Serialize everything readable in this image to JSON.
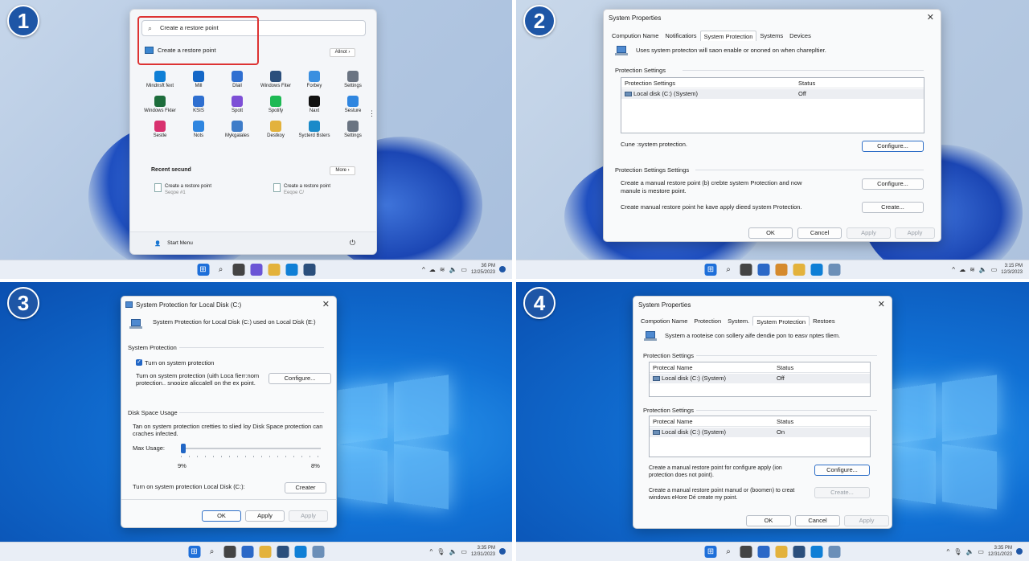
{
  "steps": [
    "1",
    "2",
    "3",
    "4"
  ],
  "q1": {
    "search_value": "Create a restore point",
    "result_label": "Create a restore point",
    "all_label": "Allnot",
    "apps": [
      {
        "label": "Mindnsft fext",
        "icon": "edge-icon",
        "color": "#0f7fd6"
      },
      {
        "label": "Mill",
        "icon": "mail-icon",
        "color": "#1467c7"
      },
      {
        "label": "Dlail",
        "icon": "calendar-icon",
        "color": "#2f6fd1"
      },
      {
        "label": "Windows Fiter",
        "icon": "store-icon",
        "color": "#2b4f7c"
      },
      {
        "label": "Forbey",
        "icon": "photos-icon",
        "color": "#3a8fe0"
      },
      {
        "label": "Settings",
        "icon": "gear-icon",
        "color": "#6a7482"
      },
      {
        "label": "Windows Fkter",
        "icon": "office-icon",
        "color": "#1d6d3c"
      },
      {
        "label": "KSIS",
        "icon": "xbox-icon",
        "color": "#2e6fd0"
      },
      {
        "label": "Spott",
        "icon": "visual-studio-icon",
        "color": "#7d4fd6"
      },
      {
        "label": "Spotify",
        "icon": "spotify-icon",
        "color": "#1db954"
      },
      {
        "label": "Naxt",
        "icon": "netflix-icon",
        "color": "#111111"
      },
      {
        "label": "Sesture",
        "icon": "todo-icon",
        "color": "#2f86e0"
      },
      {
        "label": "Sestle",
        "icon": "instagram-icon",
        "color": "#d8316f"
      },
      {
        "label": "Nots",
        "icon": "check-icon",
        "color": "#2f86e0"
      },
      {
        "label": "Mykgalales",
        "icon": "gallery-icon",
        "color": "#3d7cc9"
      },
      {
        "label": "Destkoy",
        "icon": "folder-icon",
        "color": "#e3b23c"
      },
      {
        "label": "Sycterd Bsters",
        "icon": "snipping-icon",
        "color": "#1a8ac9"
      },
      {
        "label": "Settings",
        "icon": "gear-icon",
        "color": "#6a7482"
      }
    ],
    "recent_heading": "Recent secund",
    "more_label": "More",
    "recent": [
      {
        "title": "Create a restore point",
        "sub": "Seqoe #1"
      },
      {
        "title": "Create a restore point",
        "sub": "Eeqoe C/"
      }
    ],
    "user_label": "Start Menu",
    "clock_time": "3б PM",
    "clock_date": "12/25/2023"
  },
  "q2": {
    "title": "System Properties",
    "tabs": [
      "Compution Name",
      "Notificatiors",
      "System Protection",
      "Systems",
      "Devices"
    ],
    "intro": "Uses system protecton will saon enable or ononed on when charepltier.",
    "section1": "Protection Settings",
    "col1": "Protection Settings",
    "col2": "Status",
    "row_drive": "Local disk (C:) (System)",
    "row_status": "Off",
    "cune_label": "Cune :system protection.",
    "configure": "Configure...",
    "section2": "Protection Settings Settings",
    "desc1": "Create a manual restore point (b) crebte system Protection and now manule is mestore point.",
    "configure2": "Configure...",
    "desc2": "Create manual restore point he kave apply dieed system Protection.",
    "create": "Create...",
    "ok": "OK",
    "cancel": "Cancel",
    "apply1": "Apply",
    "apply2": "Apply",
    "clock_time": "3:15 PM",
    "clock_date": "12/3/2023"
  },
  "q3": {
    "title": "System Protection for Local Disk (C:)",
    "intro": "System Protection for Local Disk (C:) used on Local Disk (E:)",
    "section1": "System Protection",
    "checkbox_label": "Turn on system protection",
    "desc1": "Turn on system protection (uith Loca fierr:nom protection.. snooize aliccalell on the ex point.",
    "configure": "Configure...",
    "section2": "Disk Space Usage",
    "desc2": "Tan on system protection cretties to slied loy Disk Space protection can craches infected.",
    "max_usage_label": "Max Usage:",
    "slider_value": 0.0,
    "slider_min": "9%",
    "slider_max": "8%",
    "turn_on_label": "Turn on system protection  Local Disk (C:):",
    "creater": "Creater",
    "ok": "OK",
    "apply1": "Apply",
    "apply2": "Apply",
    "clock_time": "3:35 PM",
    "clock_date": "12/31/2023"
  },
  "q4": {
    "title": "System Properties",
    "tabs": [
      "Compotion Name",
      "Protection",
      "System.",
      "System Protection",
      "Restoes"
    ],
    "intro": "System a rooteise con sollery aife dendie pon to easv nptes tliem.",
    "section1": "Protection Settings",
    "t1_col1": "Protecal Name",
    "t1_col2": "Status",
    "t1_drive": "Local disk (C:) (System)",
    "t1_status": "Off",
    "section2": "Protection Settings",
    "t2_col1": "Protecal Name",
    "t2_col2": "Status",
    "t2_drive": "Local disk (C:) (System)",
    "t2_status": "On",
    "desc1": "Create a manual restore point for configure apply (ion protection does not point).",
    "configure": "Configure...",
    "desc2": "Create a manual restore point manud or (boomen) to creat windows eHore Dé create my point.",
    "create": "Create...",
    "ok": "OK",
    "cancel": "Cancel",
    "apply": "Apply",
    "clock_time": "3:35 PM",
    "clock_date": "12/31/2023"
  },
  "colors": {
    "accent": "#2166c5",
    "highlight_box": "#d33333",
    "badge": "#1e56a6"
  }
}
